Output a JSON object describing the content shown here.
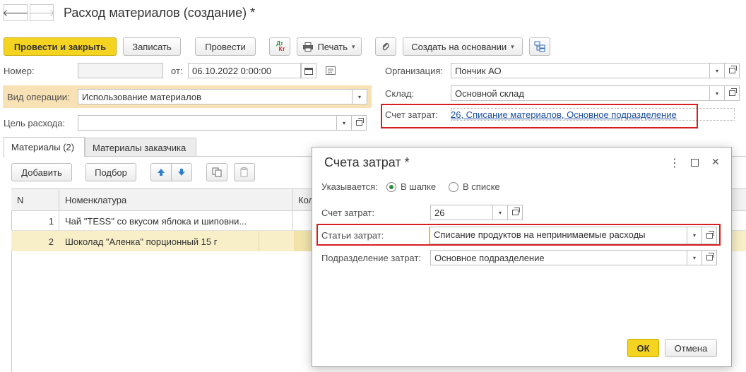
{
  "header": {
    "title": "Расход материалов (создание) *",
    "back_glyph": "🡐",
    "forward_glyph": "🡒"
  },
  "toolbar": {
    "post_close": "Провести и закрыть",
    "save": "Записать",
    "post": "Провести",
    "dt_top": "Дт",
    "dt_bottom": "Кт",
    "print": "Печать",
    "create_based": "Создать на основании",
    "caret": "▾"
  },
  "form": {
    "number_label": "Номер:",
    "number_value": "",
    "date_from_label": "от:",
    "date_value": "06.10.2022  0:00:00",
    "operation_label": "Вид операции:",
    "operation_value": "Использование материалов",
    "purpose_label": "Цель расхода:",
    "purpose_value": "",
    "org_label": "Организация:",
    "org_value": "Пончик АО",
    "warehouse_label": "Склад:",
    "warehouse_value": "Основной склад",
    "account_label": "Счет затрат:",
    "account_link": "26, Списание материалов, Основное подразделение"
  },
  "tabs": [
    {
      "label": "Материалы (2)"
    },
    {
      "label": "Материалы заказчика"
    }
  ],
  "table_toolbar": {
    "add": "Добавить",
    "pick": "Подбор"
  },
  "table": {
    "columns": [
      "N",
      "Номенклатура",
      "Кол"
    ],
    "rows": [
      {
        "n": "1",
        "item": "Чай \"TESS\" со вкусом яблока и шиповни..."
      },
      {
        "n": "2",
        "item": "Шоколад \"Аленка\" порционный 15 г"
      }
    ]
  },
  "dialog": {
    "title": "Счета затрат *",
    "specified_label": "Указывается:",
    "radio_header": "В шапке",
    "radio_list": "В списке",
    "radio_selected": "header",
    "account_label": "Счет затрат:",
    "account_value": "26",
    "items_label": "Статьи затрат:",
    "items_value": "Списание продуктов на непринимаемые расходы",
    "division_label": "Подразделение затрат:",
    "division_value": "Основное подразделение",
    "ok": "ОК",
    "cancel": "Отмена",
    "menu_glyph": "⋮",
    "close_glyph": "✕"
  },
  "colors": {
    "primary_button": "#f5d321",
    "highlight_box": "#d71f1f",
    "link": "#1c4f9c",
    "selected_row": "#f8efc8",
    "operation_row": "#f7e1b5"
  }
}
